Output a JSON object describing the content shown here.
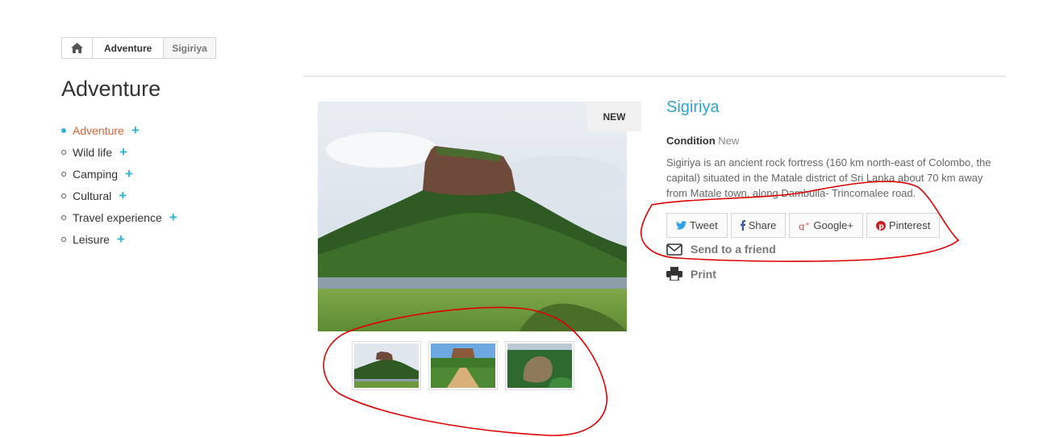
{
  "breadcrumb": {
    "home_icon": "home-icon",
    "category": "Adventure",
    "current": "Sigiriya"
  },
  "sidebar": {
    "title": "Adventure",
    "items": [
      {
        "label": "Adventure",
        "active": true
      },
      {
        "label": "Wild life",
        "active": false
      },
      {
        "label": "Camping",
        "active": false
      },
      {
        "label": "Cultural",
        "active": false
      },
      {
        "label": "Travel experience",
        "active": false
      },
      {
        "label": "Leisure",
        "active": false
      }
    ],
    "expand_icon": "plus-icon"
  },
  "product": {
    "badge": "NEW",
    "name": "Sigiriya",
    "condition_label": "Condition",
    "condition_value": "New",
    "description": "Sigiriya is an ancient rock fortress (160 km north-east of Colombo, the capital) situated in the Matale district of Sri Lanka about 70 km away from Matale town, along Dambulla- Trincomalee road.",
    "thumbnails": [
      "sigiriya-rock-thumb",
      "garden-path-thumb",
      "aerial-rock-thumb"
    ]
  },
  "share": {
    "tweet": "Tweet",
    "share": "Share",
    "google": "Google+",
    "pinterest": "Pinterest"
  },
  "actions": {
    "send": "Send to a friend",
    "print": "Print"
  },
  "colors": {
    "accent": "#2fb5d2",
    "title": "#2fa3c8",
    "active_category": "#e4602f",
    "annotation": "#e00000"
  }
}
